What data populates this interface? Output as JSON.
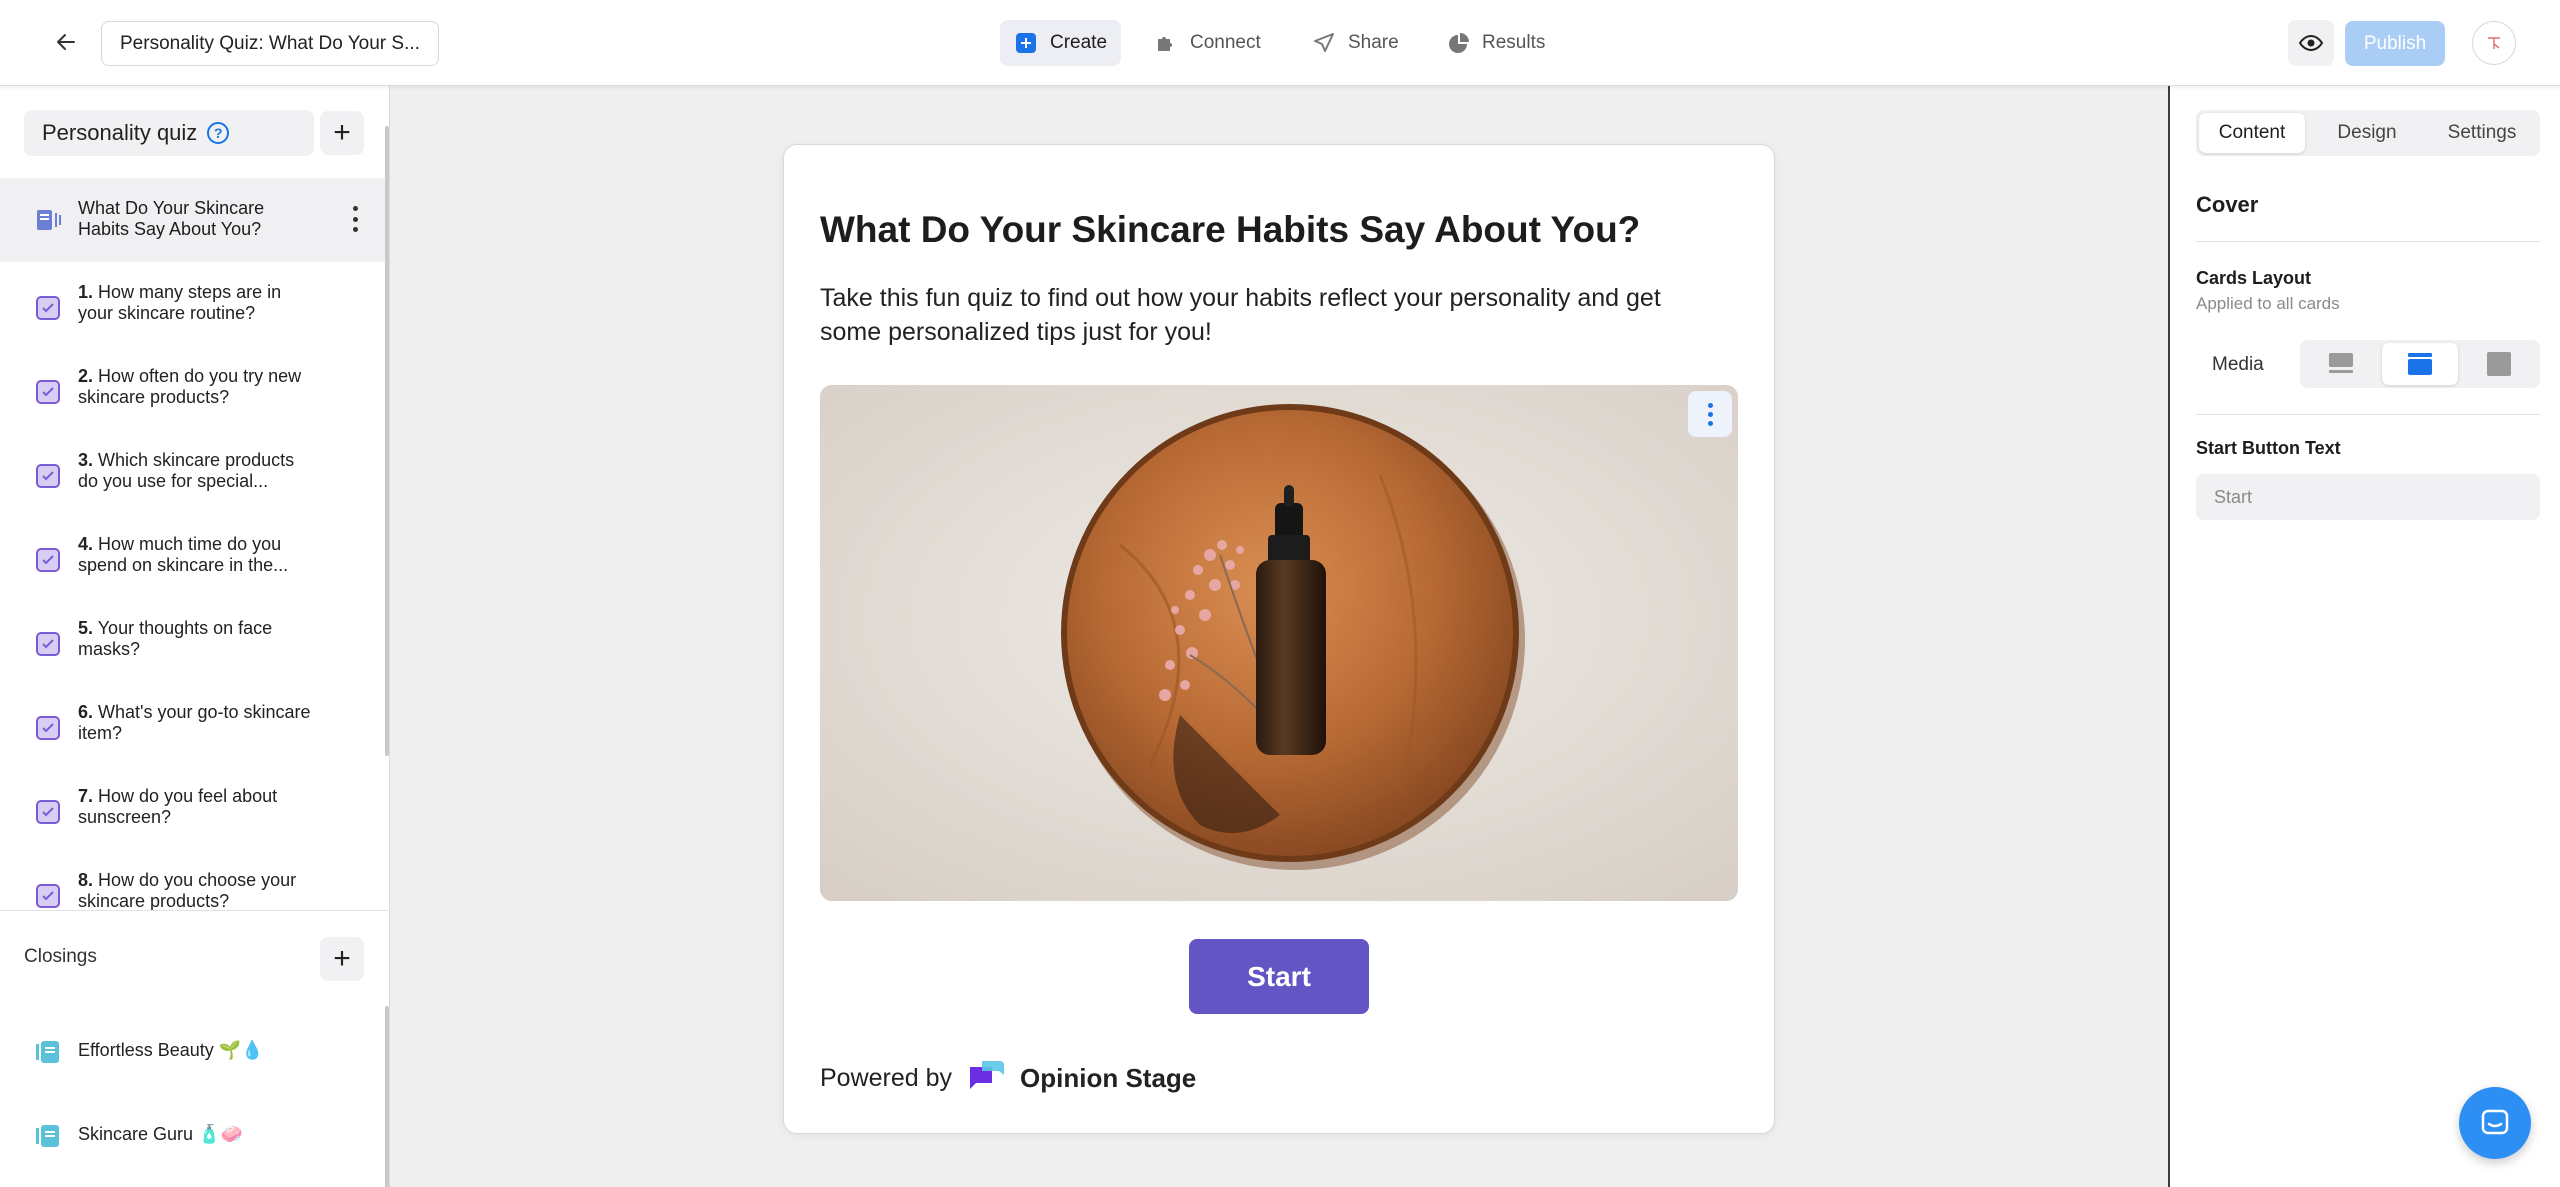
{
  "header": {
    "quiz_title": "Personality Quiz: What Do Your S...",
    "nav": [
      {
        "label": "Create",
        "icon": "plus-square-icon",
        "active": true
      },
      {
        "label": "Connect",
        "icon": "puzzle-icon",
        "active": false
      },
      {
        "label": "Share",
        "icon": "send-icon",
        "active": false
      },
      {
        "label": "Results",
        "icon": "pie-chart-icon",
        "active": false
      }
    ],
    "publish_label": "Publish",
    "colors": {
      "accent": "#1a73e8",
      "publish_disabled": "#a9cdf5"
    }
  },
  "sidebar": {
    "quiz_type": "Personality quiz",
    "cover": {
      "label": "What Do Your Skincare Habits Say About You?"
    },
    "questions": [
      {
        "num": "1.",
        "text": "How many steps are in your skincare routine?"
      },
      {
        "num": "2.",
        "text": "How often do you try new skincare products?"
      },
      {
        "num": "3.",
        "text": "Which skincare products do you use for special..."
      },
      {
        "num": "4.",
        "text": "How much time do you spend on skincare in the..."
      },
      {
        "num": "5.",
        "text": "Your thoughts on face masks?"
      },
      {
        "num": "6.",
        "text": "What's your go-to skincare item?"
      },
      {
        "num": "7.",
        "text": "How do you feel about sunscreen?"
      },
      {
        "num": "8.",
        "text": "How do you choose your skincare products?"
      }
    ],
    "closings_label": "Closings",
    "closings": [
      {
        "text": "Effortless Beauty 🌱💧"
      },
      {
        "text": "Skincare Guru 🧴🧼"
      }
    ]
  },
  "card": {
    "title": "What Do Your Skincare Habits Say About You?",
    "description": "Take this fun quiz to find out how your habits reflect your personality and get some personalized tips just for you!",
    "start_label": "Start",
    "powered_by": "Powered by",
    "brand": "Opinion Stage",
    "button_color": "#6356c4"
  },
  "right_panel": {
    "tabs": [
      {
        "label": "Content",
        "active": true
      },
      {
        "label": "Design",
        "active": false
      },
      {
        "label": "Settings",
        "active": false
      }
    ],
    "section_title": "Cover",
    "cards_layout_label": "Cards Layout",
    "cards_layout_sub": "Applied to all cards",
    "media_label": "Media",
    "media_options": [
      "media-left-icon",
      "media-top-icon",
      "media-background-icon"
    ],
    "start_button_text_label": "Start Button Text",
    "start_button_placeholder": "Start"
  }
}
